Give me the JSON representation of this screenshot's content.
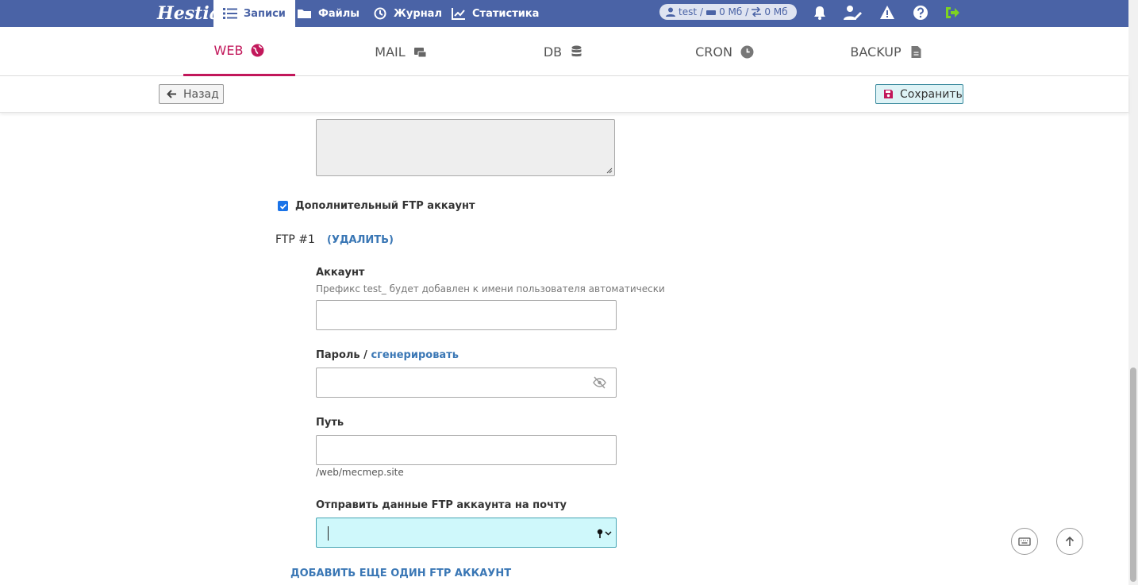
{
  "topbar": {
    "logo_text": "Hestia",
    "nav": [
      {
        "label": "Записи",
        "icon": "list-icon",
        "active": true
      },
      {
        "label": "Файлы",
        "icon": "folder-icon"
      },
      {
        "label": "Журнал",
        "icon": "history-icon"
      },
      {
        "label": "Статистика",
        "icon": "chart-icon"
      }
    ],
    "usage": {
      "user": "test",
      "separator": "/",
      "disk": "0 Мб",
      "bandwidth": "0 Мб"
    },
    "icons": [
      "bell-icon",
      "user-edit-icon",
      "warning-icon",
      "help-icon",
      "logout-icon"
    ],
    "colors": {
      "bar": "#4a63a6",
      "logout": "#7ed321"
    }
  },
  "tabs": [
    {
      "label": "WEB",
      "icon": "globe-icon",
      "active": true
    },
    {
      "label": "MAIL",
      "icon": "mail-icon"
    },
    {
      "label": "DB",
      "icon": "database-icon"
    },
    {
      "label": "CRON",
      "icon": "clock-icon"
    },
    {
      "label": "BACKUP",
      "icon": "file-icon"
    }
  ],
  "toolbar": {
    "back_label": "Назад",
    "save_label": "Сохранить"
  },
  "form": {
    "cut_text": "— — — — — — — — — —",
    "extra_ftp_label": "Дополнительный FTP аккаунт",
    "extra_ftp_checked": true,
    "ftp_heading": "FTP #1",
    "ftp_delete": "(УДАЛИТЬ)",
    "account_label": "Аккаунт",
    "account_hint": "Префикс test_ будет добавлен к имени пользователя автоматически",
    "account_value": "",
    "password_label": "Пароль /",
    "password_generate": "сгенерировать",
    "password_value": "",
    "path_label": "Путь",
    "path_value": "",
    "path_hint": "/web/mecmep.site",
    "notify_label": "Отправить данные FTP аккаунта на почту",
    "notify_value": "",
    "add_more": "ДОБАВИТЬ ЕЩЕ ОДИН FTP АККАУНТ"
  }
}
